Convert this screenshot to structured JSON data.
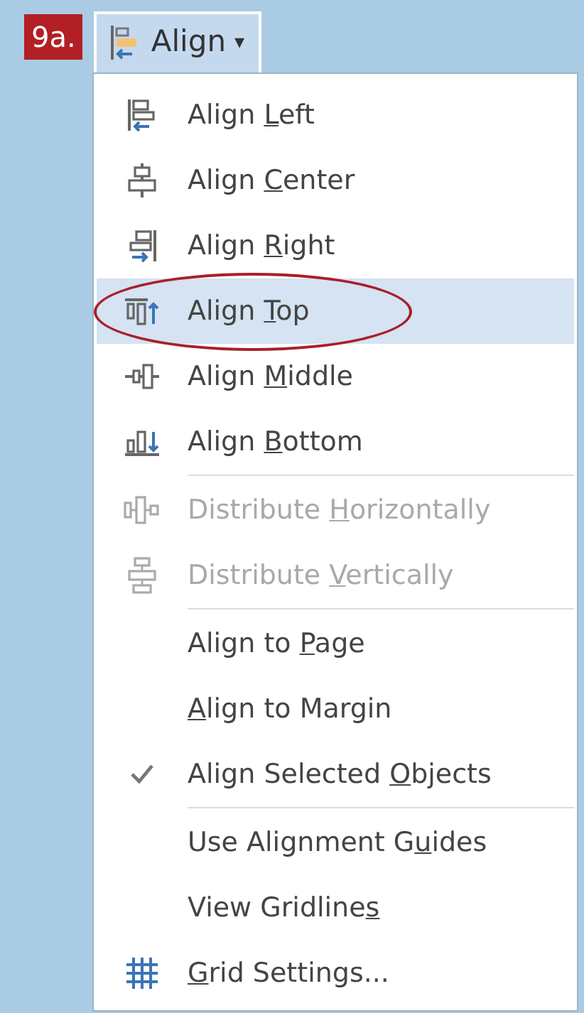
{
  "step_badge": "9a.",
  "align_button": {
    "label": "Align",
    "caret": "▾",
    "expanded": true
  },
  "menu_groups": [
    [
      {
        "before": "Align ",
        "key": "L",
        "after": "eft",
        "selected": false,
        "disabled": false,
        "checked": false
      },
      {
        "before": "Align ",
        "key": "C",
        "after": "enter",
        "selected": false,
        "disabled": false,
        "checked": false
      },
      {
        "before": "Align ",
        "key": "R",
        "after": "ight",
        "selected": false,
        "disabled": false,
        "checked": false
      },
      {
        "before": "Align ",
        "key": "T",
        "after": "op",
        "selected": true,
        "disabled": false,
        "checked": false
      },
      {
        "before": "Align ",
        "key": "M",
        "after": "iddle",
        "selected": false,
        "disabled": false,
        "checked": false
      },
      {
        "before": "Align ",
        "key": "B",
        "after": "ottom",
        "selected": false,
        "disabled": false,
        "checked": false
      }
    ],
    [
      {
        "before": "Distribute ",
        "key": "H",
        "after": "orizontally",
        "selected": false,
        "disabled": true,
        "checked": false
      },
      {
        "before": "Distribute ",
        "key": "V",
        "after": "ertically",
        "selected": false,
        "disabled": true,
        "checked": false
      }
    ],
    [
      {
        "before": "Align to ",
        "key": "P",
        "after": "age",
        "selected": false,
        "disabled": false,
        "checked": false
      },
      {
        "key": "A",
        "after": "lign to Margin",
        "selected": false,
        "disabled": false,
        "checked": false
      },
      {
        "before": "Align Selected ",
        "key": "O",
        "after": "bjects",
        "selected": false,
        "disabled": false,
        "checked": true
      }
    ],
    [
      {
        "before": "Use Alignment G",
        "key": "u",
        "after": "ides",
        "selected": false,
        "disabled": false,
        "checked": false
      },
      {
        "before": "View Gridline",
        "key": "s",
        "selected": false,
        "disabled": false,
        "checked": false
      },
      {
        "key": "G",
        "after": "rid Settings...",
        "selected": false,
        "disabled": false,
        "checked": false
      }
    ]
  ]
}
